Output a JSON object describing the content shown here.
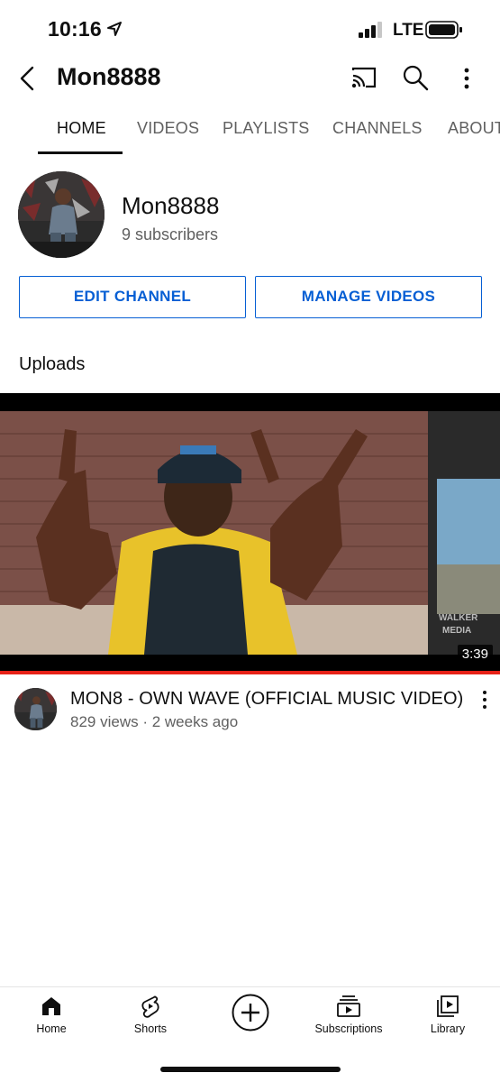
{
  "status_bar": {
    "time": "10:16",
    "carrier": "LTE"
  },
  "header": {
    "title": "Mon8888"
  },
  "tabs": [
    {
      "label": "HOME",
      "active": true
    },
    {
      "label": "VIDEOS"
    },
    {
      "label": "PLAYLISTS"
    },
    {
      "label": "CHANNELS"
    },
    {
      "label": "ABOUT"
    }
  ],
  "channel": {
    "name": "Mon8888",
    "subscribers": "9 subscribers",
    "edit_label": "EDIT CHANNEL",
    "manage_label": "MANAGE VIDEOS"
  },
  "uploads": {
    "section_label": "Uploads",
    "videos": [
      {
        "title": "MON8 - OWN WAVE (OFFICIAL MUSIC VIDEO)",
        "meta": "829 views · 2 weeks ago",
        "duration": "3:39",
        "thumbnail_watermark": "WALKER MEDIA"
      }
    ]
  },
  "bottom_nav": [
    {
      "label": "Home",
      "icon": "home-icon"
    },
    {
      "label": "Shorts",
      "icon": "shorts-icon"
    },
    {
      "label": "",
      "icon": "create-icon"
    },
    {
      "label": "Subscriptions",
      "icon": "subscriptions-icon"
    },
    {
      "label": "Library",
      "icon": "library-icon"
    }
  ],
  "colors": {
    "accent": "#065fd4",
    "progress": "#e62117",
    "text_secondary": "#606060"
  }
}
